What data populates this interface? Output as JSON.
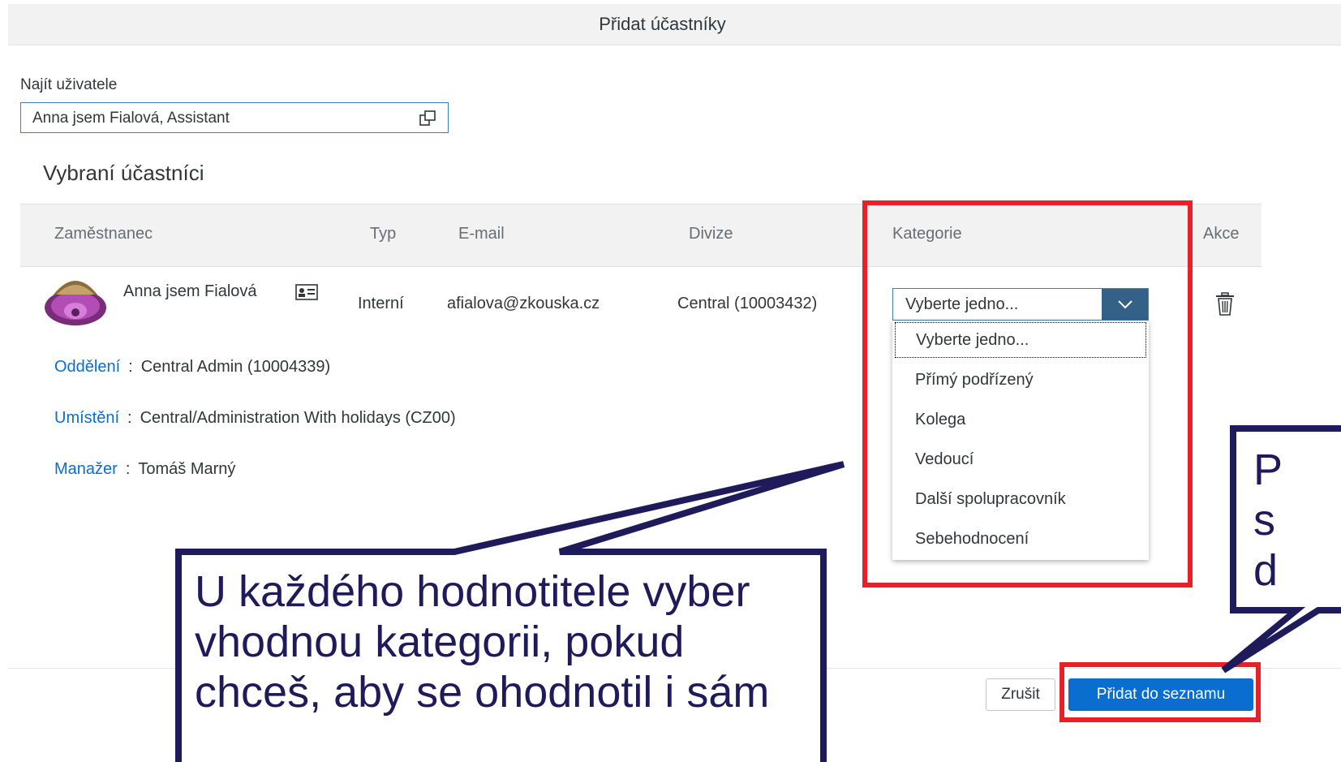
{
  "dialog": {
    "title": "Přidat účastníky"
  },
  "search": {
    "label": "Najít uživatele",
    "value": "Anna jsem Fialová, Assistant"
  },
  "section": {
    "title": "Vybraní účastníci"
  },
  "table": {
    "headers": {
      "employee": "Zaměstnanec",
      "type": "Typ",
      "email": "E-mail",
      "division": "Divize",
      "category": "Kategorie",
      "action": "Akce"
    },
    "row": {
      "name": "Anna jsem Fialová",
      "type": "Interní",
      "email": "afialova@zkouska.cz",
      "division": "Central (10003432)",
      "category_selected": "Vyberte jedno..."
    },
    "details": [
      {
        "label": "Oddělení",
        "value": "Central Admin (10004339)"
      },
      {
        "label": "Umístění",
        "value": "Central/Administration With holidays (CZ00)"
      },
      {
        "label": "Manažer",
        "value": "Tomáš Marný"
      }
    ]
  },
  "dropdown": {
    "options": [
      "Vyberte jedno...",
      "Přímý podřízený",
      "Kolega",
      "Vedoucí",
      "Další spolupracovník",
      "Sebehodnocení"
    ]
  },
  "footer": {
    "cancel_label": "Zrušit",
    "add_label": "Přidat do seznamu"
  },
  "annotations": {
    "main_callout_lines": [
      "U každého hodnotitele vyber",
      "vhodnou kategorii, pokud",
      "chceš, aby se ohodnotil i sám"
    ],
    "right_callout_lines": [
      "P",
      "s",
      "d"
    ],
    "colors": {
      "frame": "#e8202a",
      "callout_border": "#1f1b5a",
      "accent": "#0a6ed1"
    }
  },
  "icons": [
    "value-help-icon",
    "contact-card-icon",
    "chevron-down-icon",
    "trash-icon",
    "avatar"
  ]
}
